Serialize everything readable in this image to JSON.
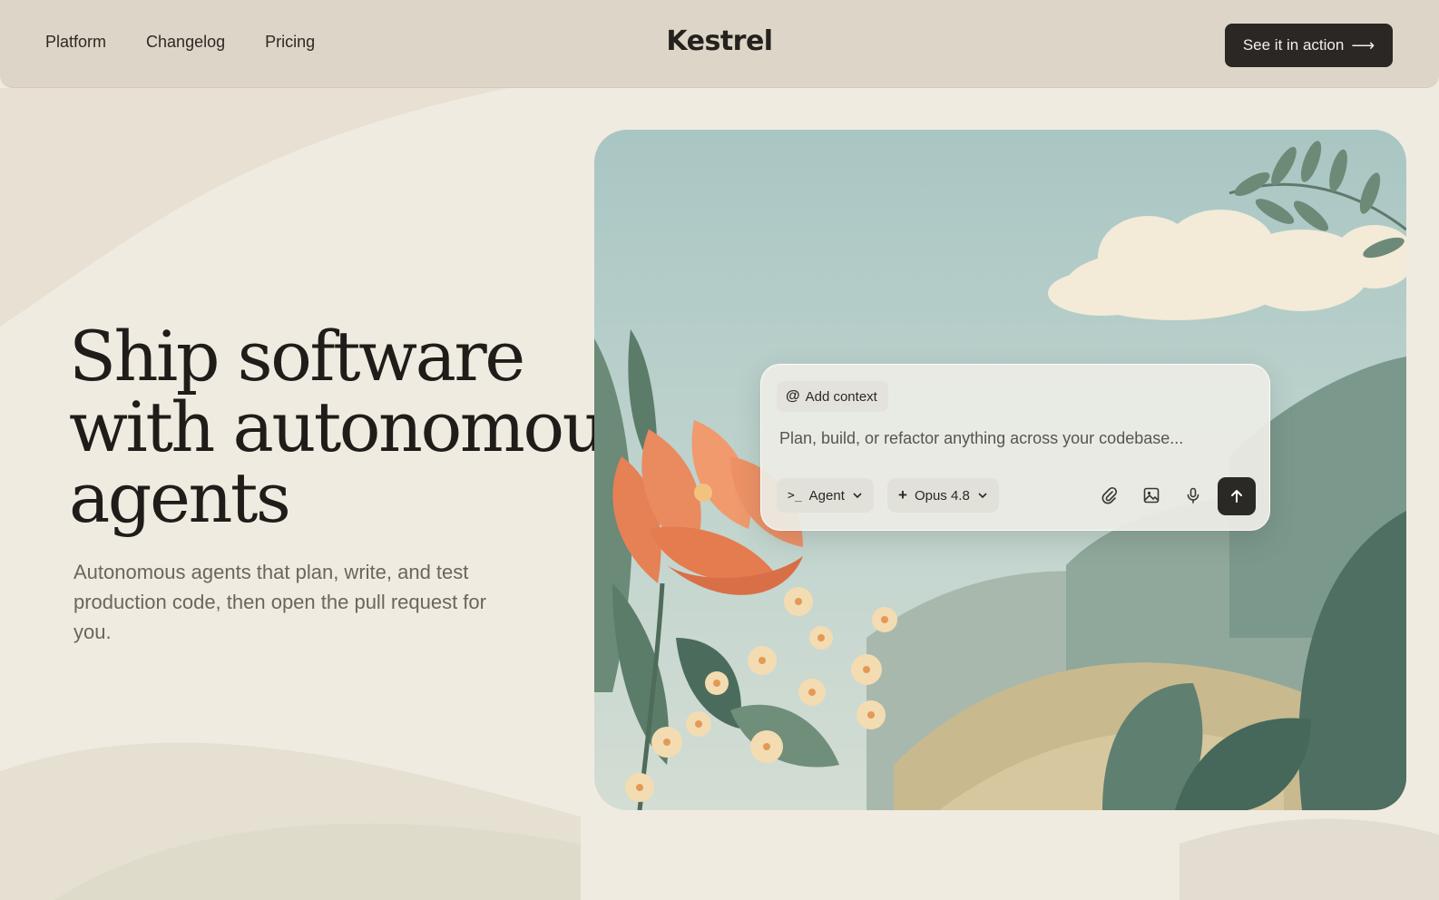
{
  "header": {
    "nav": [
      "Platform",
      "Changelog",
      "Pricing"
    ],
    "logo": "Kestrel",
    "cta_label": "See it in action",
    "cta_icon": "arrow-right-icon"
  },
  "hero": {
    "headline_lines": [
      "Ship software",
      "with autonomous",
      "agents"
    ],
    "subtext": "Autonomous agents that plan, write, and test production code, then open the pull request for you."
  },
  "prompt": {
    "context_chip": "Add context",
    "context_icon": "at-sign-icon",
    "placeholder": "Plan, build, or refactor anything across your codebase...",
    "mode": "Agent",
    "mode_icon": "terminal-icon",
    "model": "Opus 4.8",
    "model_icon": "plus-icon",
    "tools": [
      "paperclip-icon",
      "image-icon",
      "microphone-icon"
    ],
    "send_icon": "arrow-up-icon"
  },
  "colors": {
    "page_bg": "#f0ebe1",
    "header_bg": "#ddd5c7",
    "dark_button": "#2a2724",
    "sky": "#b9cfcb",
    "flower": "#e98a5f"
  }
}
